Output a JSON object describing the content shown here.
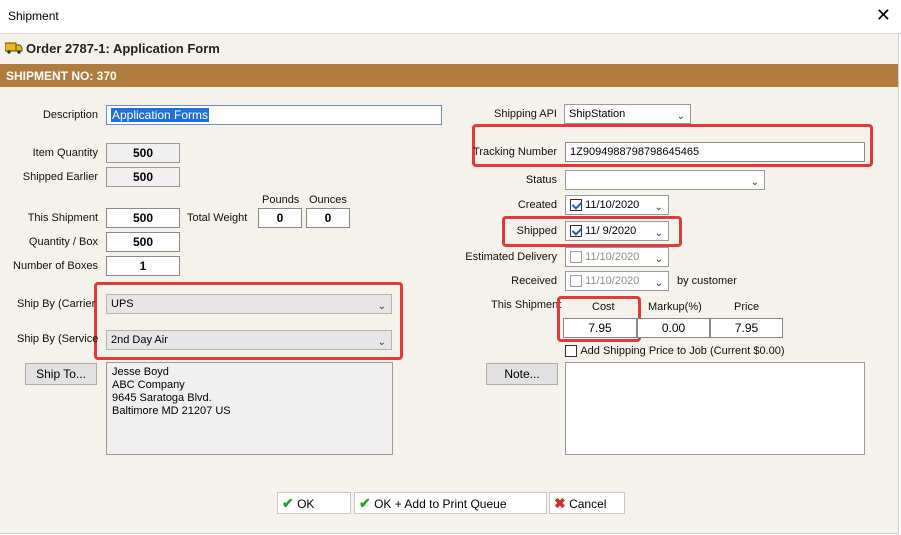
{
  "window": {
    "title": "Shipment",
    "close_glyph": "✕"
  },
  "order_title": "Order 2787-1: Application Form",
  "banner": "SHIPMENT NO: 370",
  "left": {
    "description_label": "Description",
    "description_value": "Application Forms",
    "item_quantity_label": "Item Quantity",
    "item_quantity_value": "500",
    "shipped_earlier_label": "Shipped Earlier",
    "shipped_earlier_value": "500",
    "pounds_label": "Pounds",
    "ounces_label": "Ounces",
    "this_shipment_label": "This Shipment",
    "this_shipment_value": "500",
    "total_weight_label": "Total Weight",
    "pounds_value": "0",
    "ounces_value": "0",
    "qty_box_label": "Quantity / Box",
    "qty_box_value": "500",
    "num_boxes_label": "Number of Boxes",
    "num_boxes_value": "1",
    "carrier_label": "Ship By (Carrier",
    "carrier_value": "UPS",
    "service_label": "Ship By (Service",
    "service_value": "2nd Day Air",
    "ship_to_button": "Ship To...",
    "address": [
      "Jesse Boyd",
      "ABC Company",
      "9645 Saratoga Blvd.",
      "Baltimore MD 21207 US"
    ]
  },
  "right": {
    "shipping_api_label": "Shipping API",
    "shipping_api_value": "ShipStation",
    "tracking_label": "Tracking Number",
    "tracking_value": "1Z9094988798798645465",
    "status_label": "Status",
    "status_value": "",
    "created_label": "Created",
    "created_value": "11/10/2020",
    "shipped_label": "Shipped",
    "shipped_value": "11/  9/2020",
    "estimated_label": "Estimated Delivery",
    "estimated_value": "11/10/2020",
    "received_label": "Received",
    "received_value": "11/10/2020",
    "by_customer": "by customer",
    "this_shipment_label": "This Shipment",
    "cost_label": "Cost",
    "markup_label": "Markup(%)",
    "price_label": "Price",
    "cost_value": "7.95",
    "markup_value": "0.00",
    "price_value": "7.95",
    "add_shipping_label": "Add Shipping Price to Job (Current $0.00)",
    "note_button": "Note..."
  },
  "footer": {
    "ok": "OK",
    "ok_print": "OK + Add to Print Queue",
    "cancel": "Cancel"
  },
  "colors": {
    "banner": "#b07d3e",
    "highlight": "#e03a3a",
    "selection": "#1e6fd6"
  }
}
